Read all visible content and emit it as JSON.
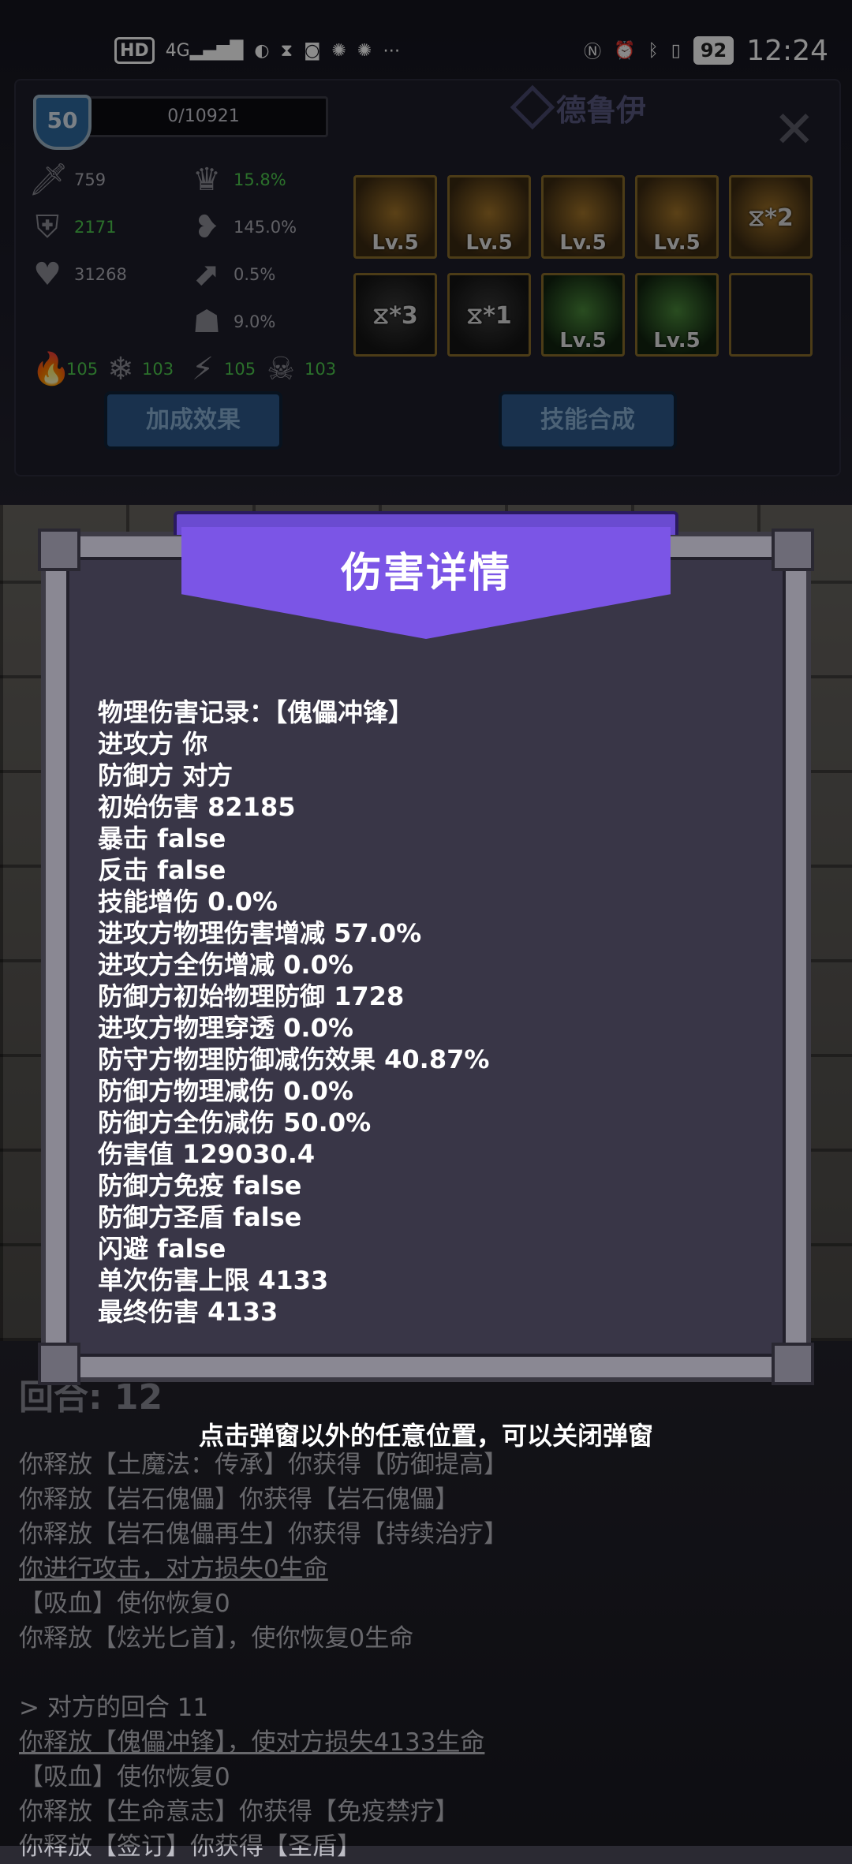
{
  "status_bar": {
    "network": "4G",
    "battery": "92",
    "time": "12:24"
  },
  "hero": {
    "level": "50",
    "exp": "0/10921",
    "name": "德鲁伊",
    "stats": [
      {
        "icon": "sword-icon",
        "value": "759"
      },
      {
        "icon": "crown-icon",
        "value": "15.8%"
      },
      {
        "icon": "shield-icon",
        "value": "2171"
      },
      {
        "icon": "broken-heart-icon",
        "value": "145.0%"
      },
      {
        "icon": "heart-icon",
        "value": "31268"
      },
      {
        "icon": "boot-icon",
        "value": "0.5%"
      },
      {
        "icon": "skull-mask-icon",
        "value": "9.0%"
      }
    ],
    "elements": [
      {
        "icon": "fire-icon",
        "value": "105"
      },
      {
        "icon": "snowflake-icon",
        "value": "103"
      },
      {
        "icon": "lightning-icon",
        "value": "105"
      },
      {
        "icon": "poison-skull-icon",
        "value": "103"
      }
    ],
    "skills_row1": [
      "Lv.5",
      "Lv.5",
      "Lv.5",
      "Lv.5",
      "⧖*2"
    ],
    "skills_row2": [
      "⧖*3",
      "⧖*1",
      "Lv.5",
      "Lv.5",
      ""
    ],
    "buttons": {
      "bonus": "加成效果",
      "combine": "技能合成"
    }
  },
  "modal": {
    "title": "伤害详情",
    "lines": [
      "物理伤害记录：【傀儡冲锋】",
      "进攻方 你",
      "防御方 对方",
      "初始伤害 82185",
      "暴击 false",
      "反击 false",
      "技能增伤 0.0%",
      "进攻方物理伤害增减 57.0%",
      "进攻方全伤增减 0.0%",
      "防御方初始物理防御 1728",
      "进攻方物理穿透 0.0%",
      "防守方物理防御减伤效果 40.87%",
      "防御方物理减伤 0.0%",
      "防御方全伤减伤 50.0%",
      "伤害值 129030.4",
      "防御方免疫 false",
      "防御方圣盾 false",
      "闪避 false",
      "单次伤害上限 4133",
      "最终伤害 4133"
    ]
  },
  "round": "回合: 12",
  "hint": "点击弹窗以外的任意位置，可以关闭弹窗",
  "log": [
    {
      "text": "你释放【土魔法：传承】你获得【防御提高】",
      "underline": false
    },
    {
      "text": "你释放【岩石傀儡】你获得【岩石傀儡】",
      "underline": false
    },
    {
      "text": "你释放【岩石傀儡再生】你获得【持续治疗】",
      "underline": false
    },
    {
      "text": "你进行攻击，对方损失0生命",
      "underline": true
    },
    {
      "text": "【吸血】使你恢复0",
      "underline": false
    },
    {
      "text": "你释放【炫光匕首】，使你恢复0生命",
      "underline": false
    },
    {
      "text": "",
      "underline": false
    },
    {
      "text": "> 对方的回合 11",
      "underline": false
    },
    {
      "text": "你释放【傀儡冲锋】，使对方损失4133生命",
      "underline": true
    },
    {
      "text": "【吸血】使你恢复0",
      "underline": false
    },
    {
      "text": "你释放【生命意志】你获得【免疫禁疗】",
      "underline": false
    },
    {
      "text": "你释放【签订】你获得【圣盾】",
      "underline": false
    }
  ]
}
